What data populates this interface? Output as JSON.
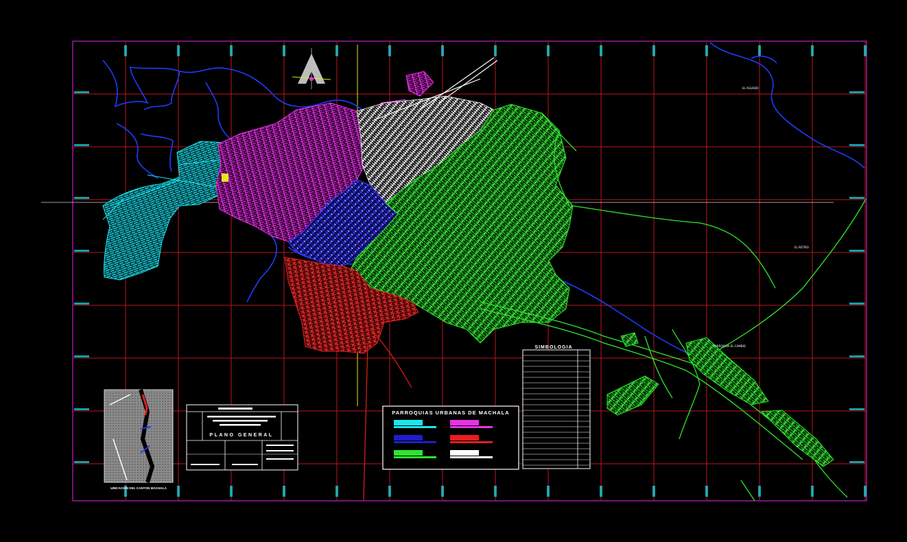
{
  "map": {
    "legend_title": "PARROQUIAS URBANAS DE MACHALA",
    "symbology_title": "SIMBOLOGIA",
    "plan_title": "PLANO GENERAL",
    "location_caption": "UBICACION DEL CANTON MACHALA",
    "labels": {
      "place_right": "PARROQUIA EL CAMBIO",
      "place_east": "EL RETIRO",
      "place_ne": "EL AGUADO"
    }
  },
  "colors": {
    "grid": "#c0141e",
    "frame": "#c020c8",
    "cyan": "#19e6f0",
    "magenta": "#e632e6",
    "white": "#ffffff",
    "blue": "#1e1ec8",
    "green": "#2ee62e",
    "red": "#e61e1e",
    "river": "#1e3cff",
    "axis_yellow": "#e6e61e"
  },
  "legend_swatches": [
    "cyan",
    "magenta",
    "blue",
    "red",
    "green",
    "white"
  ]
}
